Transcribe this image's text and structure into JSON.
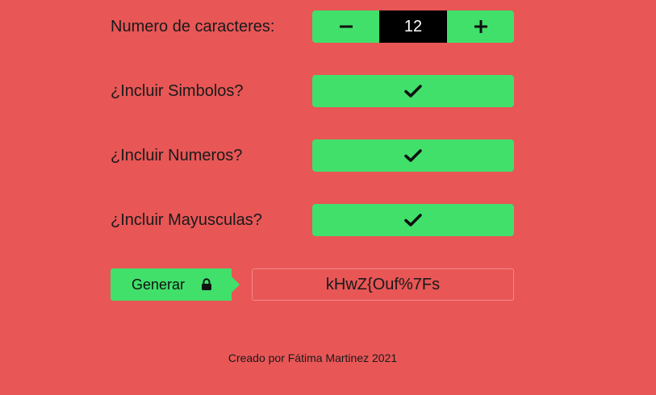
{
  "form": {
    "length": {
      "label": "Numero de caracteres:",
      "value": "12",
      "decrease_icon": "minus-icon",
      "increase_icon": "plus-icon"
    },
    "symbols": {
      "label": "¿Incluir Simbolos?",
      "checked": true,
      "icon": "check-icon"
    },
    "numbers": {
      "label": "¿Incluir Numeros?",
      "checked": true,
      "icon": "check-icon"
    },
    "uppercase": {
      "label": "¿Incluir Mayusculas?",
      "checked": true,
      "icon": "check-icon"
    }
  },
  "generate": {
    "label": "Generar",
    "icon": "lock-icon"
  },
  "output": {
    "password": "kHwZ{Ouf%7Fs"
  },
  "footer": {
    "text": "Creado por Fátima Martinez 2021"
  },
  "colors": {
    "background": "#e85656",
    "accent": "#41e06b",
    "value_bg": "#000000"
  }
}
